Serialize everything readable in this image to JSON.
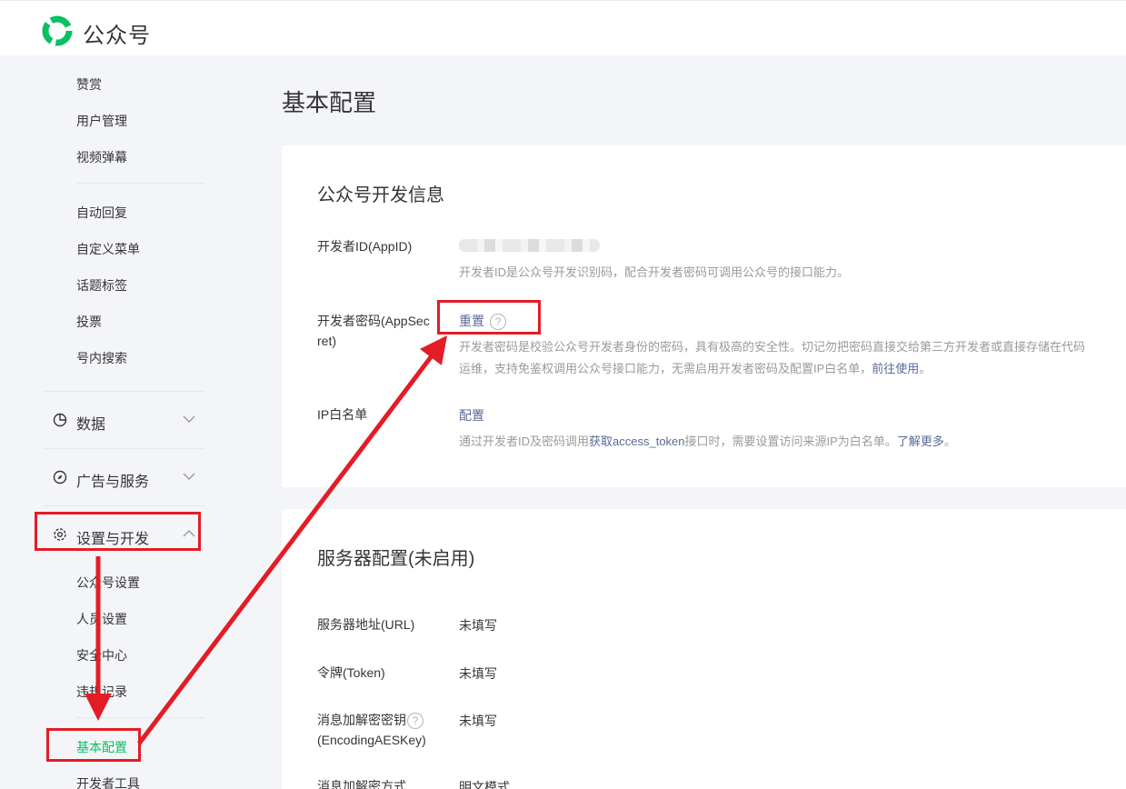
{
  "header": {
    "brand": "公众号"
  },
  "sidebar": {
    "items_top": [
      {
        "label": "赞赏"
      },
      {
        "label": "用户管理"
      },
      {
        "label": "视频弹幕"
      }
    ],
    "items_mid": [
      {
        "label": "自动回复"
      },
      {
        "label": "自定义菜单"
      },
      {
        "label": "话题标签"
      },
      {
        "label": "投票"
      },
      {
        "label": "号内搜索"
      }
    ],
    "groups": [
      {
        "label": "数据",
        "icon": "pie-chart-icon",
        "expanded": false
      },
      {
        "label": "广告与服务",
        "icon": "compass-icon",
        "expanded": false
      },
      {
        "label": "设置与开发",
        "icon": "gear-icon",
        "expanded": true
      }
    ],
    "settings_items": [
      {
        "label": "公众号设置"
      },
      {
        "label": "人员设置"
      },
      {
        "label": "安全中心"
      },
      {
        "label": "违规记录"
      }
    ],
    "dev_items": [
      {
        "label": "基本配置",
        "active": true
      },
      {
        "label": "开发者工具"
      }
    ]
  },
  "main": {
    "title": "基本配置",
    "dev_info": {
      "title": "公众号开发信息",
      "appid_label": "开发者ID(AppID)",
      "appid_desc": "开发者ID是公众号开发识别码，配合开发者密码可调用公众号的接口能力。",
      "secret_label": "开发者密码(AppSecret)",
      "secret_label_line1": "开发者密码(AppSec",
      "secret_label_line2": "ret)",
      "secret_action": "重置",
      "secret_desc_line1": "开发者密码是校验公众号开发者身份的密码，具有极高的安全性。切记勿把密码直接交给第三方开发者或直接存储在代码",
      "secret_desc_line2": "运维，支持免鉴权调用公众号接口能力，无需启用开发者密码及配置IP白名单，",
      "secret_desc_link": "前往使用",
      "secret_desc_end": "。",
      "ip_label": "IP白名单",
      "ip_action": "配置",
      "ip_desc_pre": "通过开发者ID及密码调用",
      "ip_desc_link1": "获取access_token",
      "ip_desc_mid": "接口时，需要设置访问来源IP为白名单。",
      "ip_desc_link2": "了解更多",
      "ip_desc_end": "。"
    },
    "server_config": {
      "title": "服务器配置(未启用)",
      "rows": [
        {
          "label": "服务器地址(URL)",
          "value": "未填写"
        },
        {
          "label": "令牌(Token)",
          "value": "未填写"
        },
        {
          "label_line1": "消息加解密密钥",
          "label_line2": "(EncodingAESKey)",
          "value": "未填写"
        },
        {
          "label": "消息加解密方式",
          "value": "明文模式"
        }
      ]
    }
  },
  "colors": {
    "accent": "#07c160",
    "link": "#576b95",
    "annotation": "#e41c25"
  }
}
